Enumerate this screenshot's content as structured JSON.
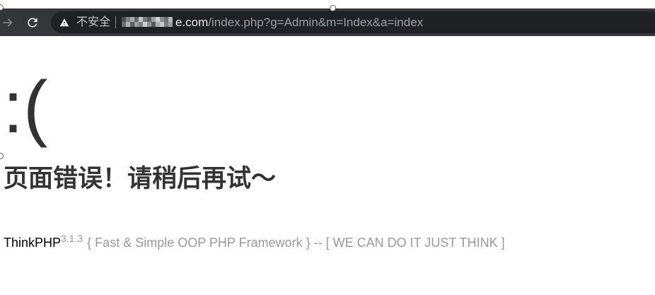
{
  "browser": {
    "forward_icon": "arrow-right-icon",
    "reload_icon": "reload-icon",
    "omnibox": {
      "security_icon": "warning-triangle-icon",
      "security_label": "不安全",
      "url_host_visible": "e.com",
      "url_path": "/index.php?g=Admin&m=Index&a=index"
    }
  },
  "page": {
    "face": ":(",
    "message": "页面错误！请稍后再试～",
    "copyright": {
      "brand": "ThinkPHP",
      "version": "3.1.3",
      "slogan": "{ Fast & Simple OOP PHP Framework } -- [ WE CAN DO IT JUST THINK ]"
    }
  },
  "colors": {
    "toolbar_bg": "#35363a",
    "omnibox_bg": "#202124",
    "url_host": "#e8eaed",
    "url_path": "#9aa0a6",
    "page_text": "#333333",
    "copyright_text": "#999999",
    "brand_link": "#000000"
  }
}
